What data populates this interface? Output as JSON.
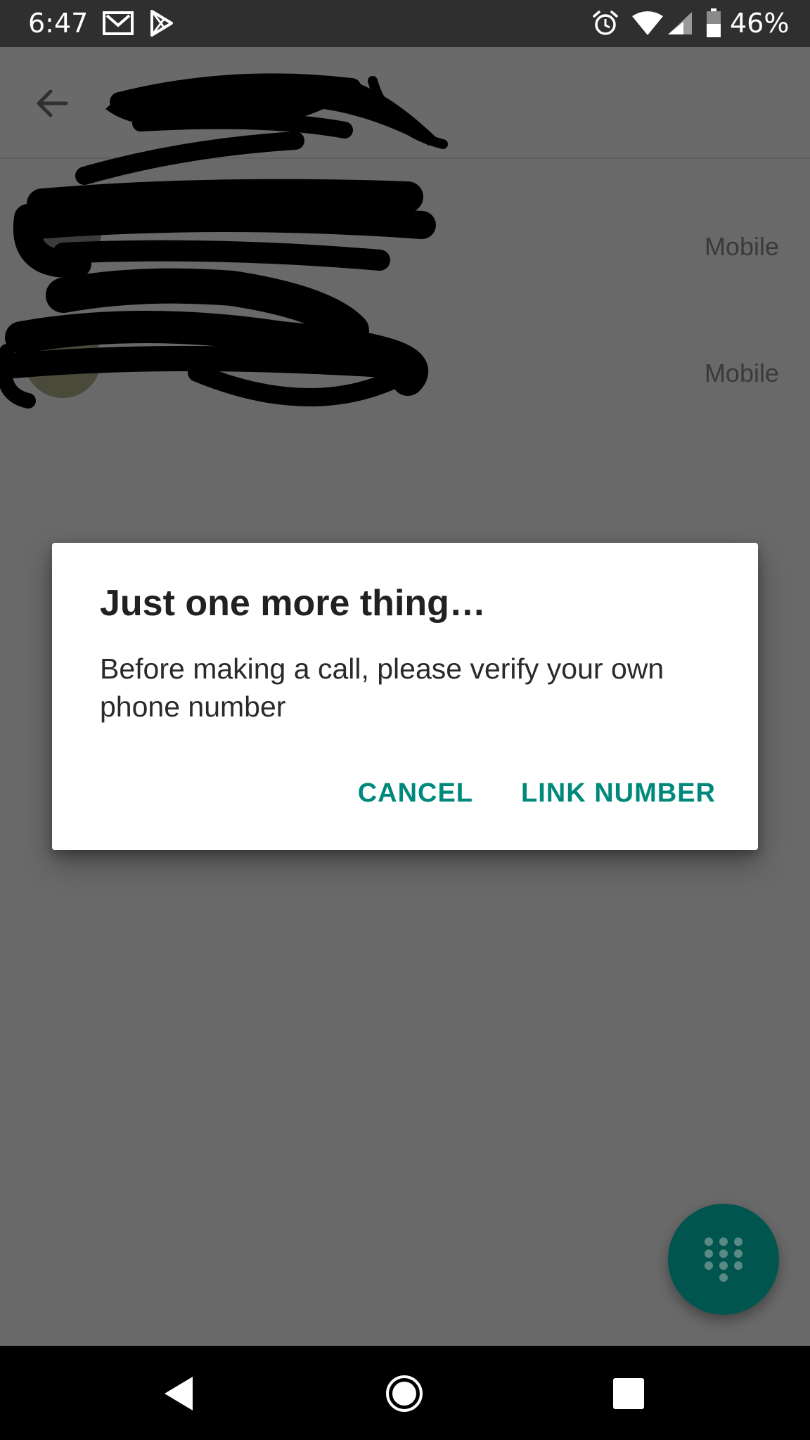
{
  "status_bar": {
    "time": "6:47",
    "battery": "46%",
    "icons": [
      "gmail-icon",
      "play-store-icon",
      "alarm-icon",
      "wifi-icon",
      "signal-icon",
      "battery-icon"
    ]
  },
  "app_bar": {
    "back_icon": "arrow-left-icon"
  },
  "contacts": [
    {
      "type": "Mobile"
    },
    {
      "type": "Mobile"
    }
  ],
  "dialog": {
    "title": "Just one more thing…",
    "message": "Before making a call, please verify your own phone number",
    "cancel_label": "CANCEL",
    "confirm_label": "LINK NUMBER"
  },
  "fab": {
    "icon": "dialpad-icon"
  },
  "nav_bar": {
    "icons": [
      "nav-back-icon",
      "nav-home-icon",
      "nav-recents-icon"
    ]
  },
  "colors": {
    "scrim": "#696969",
    "status_bar": "#2f2f2f",
    "accent": "#00897b",
    "fab": "#00564f"
  }
}
